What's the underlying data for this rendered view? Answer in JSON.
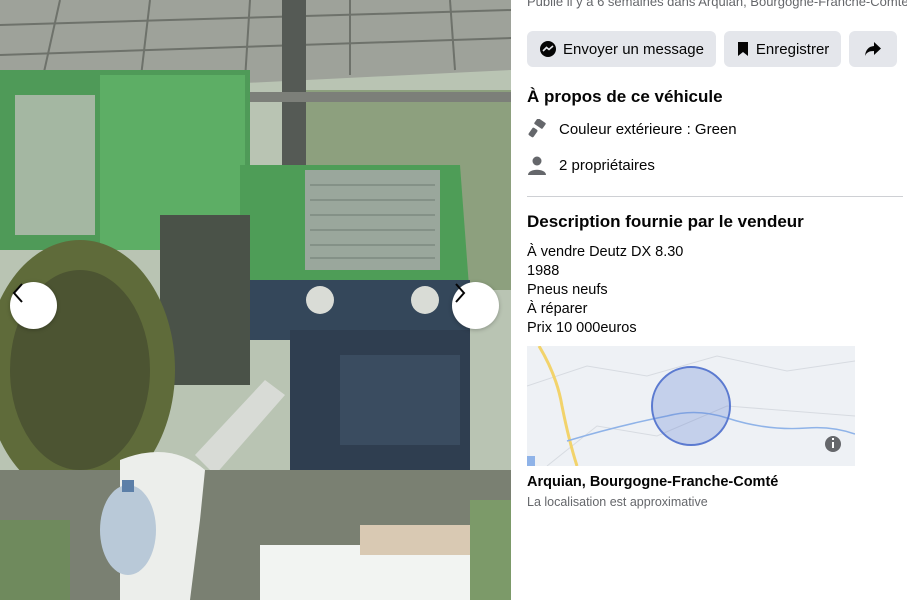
{
  "listing": {
    "posted_text": "Publié il y a 6 semaines dans Arquian, Bourgogne-Franche-Comté"
  },
  "actions": {
    "message_label": "Envoyer un message",
    "save_label": "Enregistrer",
    "share_icon": "share-icon"
  },
  "about": {
    "title": "À propos de ce véhicule",
    "color_text": "Couleur extérieure : Green",
    "owners_text": "2 propriétaires"
  },
  "description": {
    "title": "Description fournie par le vendeur",
    "lines": [
      "À vendre Deutz DX 8.30",
      "1988",
      "Pneus neufs",
      "À réparer",
      "Prix 10 000euros"
    ]
  },
  "location": {
    "name": "Arquian, Bourgogne-Franche-Comté",
    "note": "La localisation est approximative"
  },
  "colors": {
    "button_bg": "#e4e6eb",
    "secondary_text": "#65676b",
    "map_circle": "#5b7ad0"
  }
}
